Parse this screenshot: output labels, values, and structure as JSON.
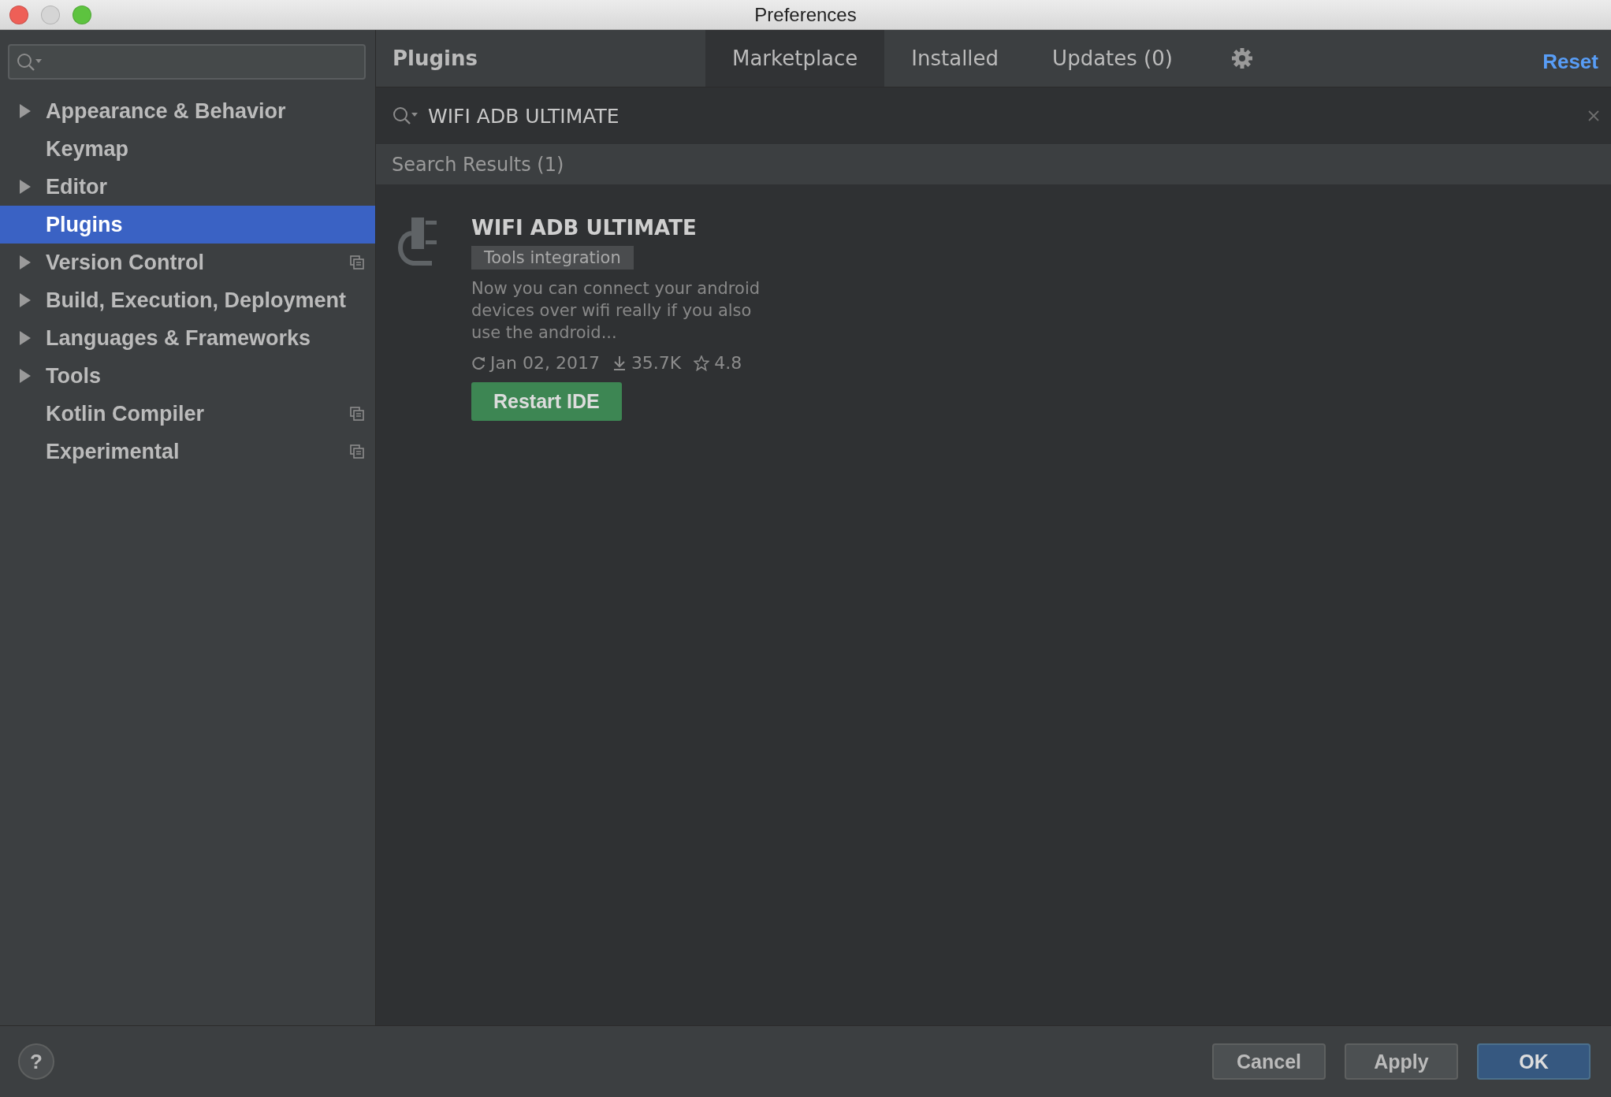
{
  "window": {
    "title": "Preferences"
  },
  "sidebar": {
    "items": [
      {
        "label": "Appearance & Behavior",
        "expandable": true,
        "selected": false,
        "project_level": false
      },
      {
        "label": "Keymap",
        "expandable": false,
        "selected": false,
        "project_level": false
      },
      {
        "label": "Editor",
        "expandable": true,
        "selected": false,
        "project_level": false
      },
      {
        "label": "Plugins",
        "expandable": false,
        "selected": true,
        "project_level": false
      },
      {
        "label": "Version Control",
        "expandable": true,
        "selected": false,
        "project_level": true
      },
      {
        "label": "Build, Execution, Deployment",
        "expandable": true,
        "selected": false,
        "project_level": false
      },
      {
        "label": "Languages & Frameworks",
        "expandable": true,
        "selected": false,
        "project_level": false
      },
      {
        "label": "Tools",
        "expandable": true,
        "selected": false,
        "project_level": false
      },
      {
        "label": "Kotlin Compiler",
        "expandable": false,
        "selected": false,
        "project_level": true
      },
      {
        "label": "Experimental",
        "expandable": false,
        "selected": false,
        "project_level": true
      }
    ]
  },
  "plugins": {
    "title": "Plugins",
    "tabs": [
      {
        "label": "Marketplace",
        "selected": true
      },
      {
        "label": "Installed",
        "selected": false
      },
      {
        "label": "Updates (0)",
        "selected": false
      }
    ],
    "reset": "Reset",
    "search": {
      "value": "WIFI ADB ULTIMATE"
    },
    "results_heading": "Search Results (1)",
    "results": [
      {
        "name": "WIFI ADB ULTIMATE",
        "tag": "Tools integration",
        "description": "Now you can connect your android devices over wifi really if you also use the android...",
        "updated": "Jan 02, 2017",
        "downloads": "35.7K",
        "rating": "4.8",
        "action": "Restart IDE"
      }
    ]
  },
  "footer": {
    "help": "?",
    "buttons": [
      {
        "label": "Cancel",
        "default": false
      },
      {
        "label": "Apply",
        "default": false
      },
      {
        "label": "OK",
        "default": true
      }
    ]
  }
}
